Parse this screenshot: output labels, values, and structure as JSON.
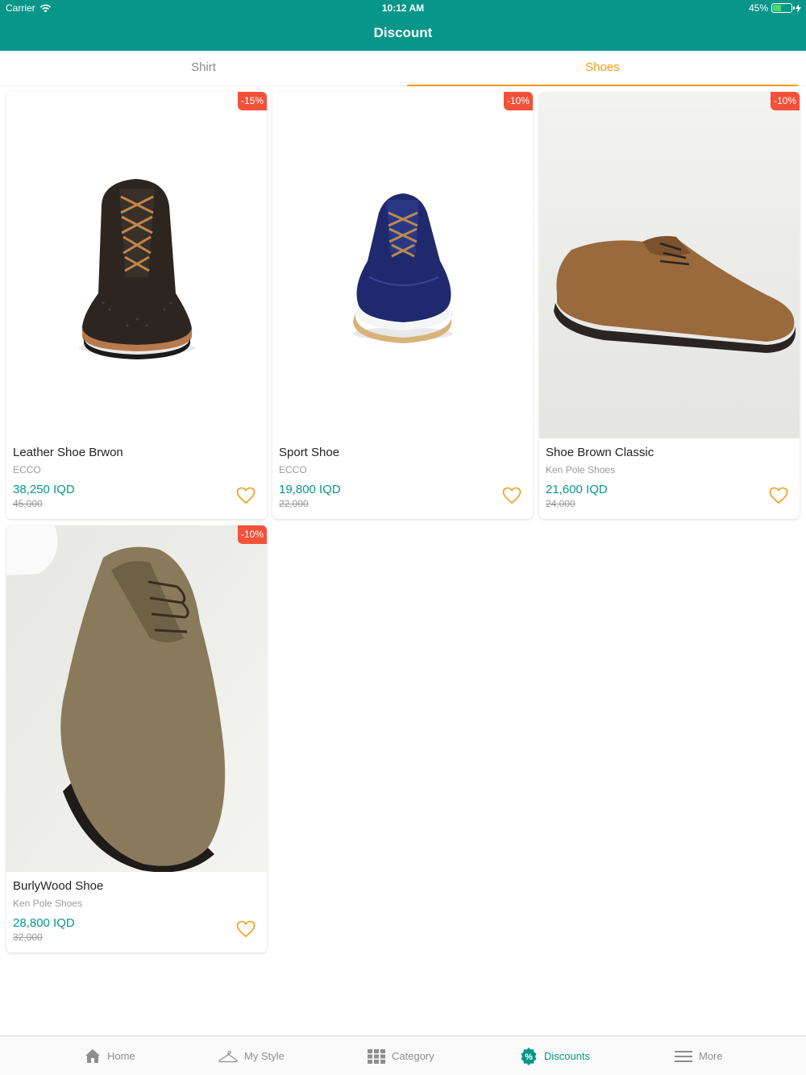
{
  "status_bar": {
    "carrier": "Carrier",
    "time": "10:12 AM",
    "battery": "45%",
    "battery_level": 0.45
  },
  "header": {
    "title": "Discount"
  },
  "tabs": [
    {
      "label": "Shirt",
      "active": false
    },
    {
      "label": "Shoes",
      "active": true
    }
  ],
  "colors": {
    "primary": "#079688",
    "accent": "#f49b12",
    "badge": "#f4513a"
  },
  "products": [
    {
      "name": "Leather Shoe Brwon",
      "brand": "ECCO",
      "price": "38,250 IQD",
      "old_price": "45,000",
      "discount": "-15%"
    },
    {
      "name": "Sport Shoe",
      "brand": "ECCO",
      "price": "19,800 IQD",
      "old_price": "22,000",
      "discount": "-10%"
    },
    {
      "name": "Shoe Brown Classic",
      "brand": "Ken Pole Shoes",
      "price": "21,600 IQD",
      "old_price": "24,000",
      "discount": "-10%"
    },
    {
      "name": "BurlyWood Shoe",
      "brand": "Ken Pole Shoes",
      "price": "28,800 IQD",
      "old_price": "32,000",
      "discount": "-10%"
    }
  ],
  "tabbar": [
    {
      "label": "Home",
      "icon": "home-icon",
      "active": false
    },
    {
      "label": "My Style",
      "icon": "hanger-icon",
      "active": false
    },
    {
      "label": "Category",
      "icon": "grid-icon",
      "active": false
    },
    {
      "label": "Discounts",
      "icon": "discount-badge-icon",
      "active": true
    },
    {
      "label": "More",
      "icon": "menu-icon",
      "active": false
    }
  ]
}
